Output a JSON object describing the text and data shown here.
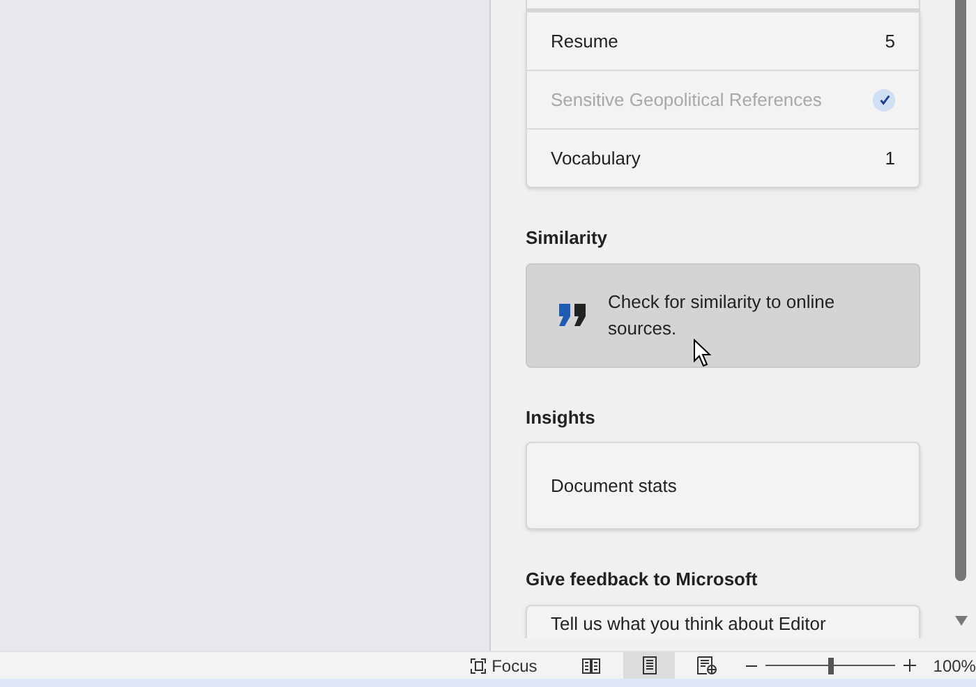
{
  "categories": [
    {
      "label": "Resume",
      "kind": "count",
      "count": "5",
      "disabled": false
    },
    {
      "label": "Sensitive Geopolitical References",
      "kind": "check",
      "disabled": true
    },
    {
      "label": "Vocabulary",
      "kind": "count",
      "count": "1",
      "disabled": false
    }
  ],
  "similarity": {
    "heading": "Similarity",
    "text": "Check for similarity to online sources.",
    "hovered": true
  },
  "insights": {
    "heading": "Insights",
    "item": "Document stats"
  },
  "feedback": {
    "heading": "Give feedback to Microsoft",
    "item": "Tell us what you think about Editor"
  },
  "status_bar": {
    "focus": "Focus",
    "views": [
      {
        "kind": "read",
        "selected": false
      },
      {
        "kind": "print",
        "selected": true
      },
      {
        "kind": "web",
        "selected": false
      }
    ],
    "zoom": {
      "level": 0.5,
      "reading": "100%"
    }
  }
}
